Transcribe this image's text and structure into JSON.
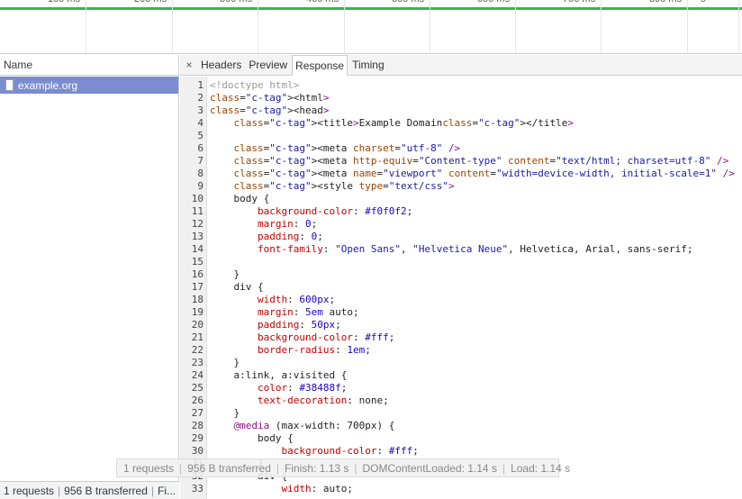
{
  "timeline": {
    "ticks": [
      "100 ms",
      "200 ms",
      "300 ms",
      "400 ms",
      "500 ms",
      "600 ms",
      "700 ms",
      "800 ms",
      "9"
    ]
  },
  "request_list": {
    "header": "Name",
    "items": [
      {
        "name": "example.org"
      }
    ]
  },
  "status": {
    "requests": "1 requests",
    "transferred": "956 B transferred",
    "finish_truncated": "Fi..."
  },
  "tabs": {
    "close": "×",
    "items": [
      "Headers",
      "Preview",
      "Response",
      "Timing"
    ],
    "active": "Response"
  },
  "summary_overlay": {
    "requests": "1 requests",
    "transferred": "956 B transferred",
    "finish": "Finish: 1.13 s",
    "dcl": "DOMContentLoaded: 1.14 s",
    "load": "Load: 1.14 s"
  },
  "code_lines": [
    "<!doctype html>",
    "<html>",
    "<head>",
    "    <title>Example Domain</title>",
    "",
    "    <meta charset=\"utf-8\" />",
    "    <meta http-equiv=\"Content-type\" content=\"text/html; charset=utf-8\" />",
    "    <meta name=\"viewport\" content=\"width=device-width, initial-scale=1\" />",
    "    <style type=\"text/css\">",
    "    body {",
    "        background-color: #f0f0f2;",
    "        margin: 0;",
    "        padding: 0;",
    "        font-family: \"Open Sans\", \"Helvetica Neue\", Helvetica, Arial, sans-serif;",
    "",
    "    }",
    "    div {",
    "        width: 600px;",
    "        margin: 5em auto;",
    "        padding: 50px;",
    "        background-color: #fff;",
    "        border-radius: 1em;",
    "    }",
    "    a:link, a:visited {",
    "        color: #38488f;",
    "        text-decoration: none;",
    "    }",
    "    @media (max-width: 700px) {",
    "        body {",
    "            background-color: #fff;",
    "        }",
    "        div {",
    "            width: auto;"
  ],
  "colors": {
    "selected_row": "#7b8ccf",
    "timeline_bar": "#39b54a"
  }
}
